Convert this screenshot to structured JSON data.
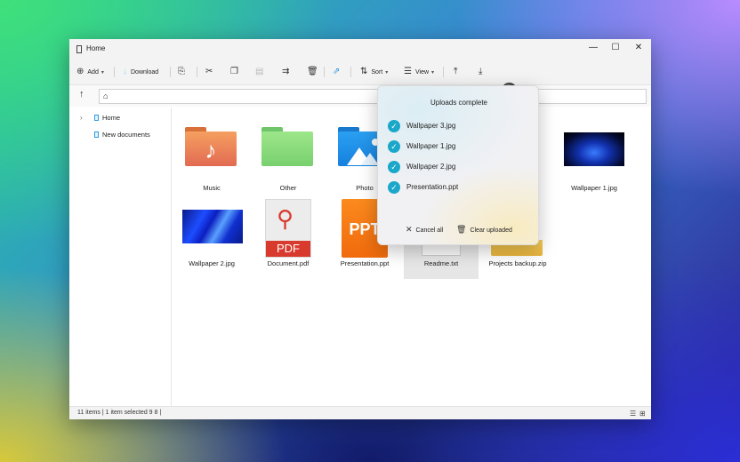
{
  "window": {
    "title": "Home",
    "minimize": "—",
    "maximize": "☐",
    "close": "✕"
  },
  "toolbar": {
    "add_label": "Add",
    "download_label": "Download",
    "sort_label": "Sort",
    "view_label": "View"
  },
  "address": {
    "path_icon": "home-icon"
  },
  "sidebar": {
    "items": [
      {
        "label": "Home",
        "icon": "document-icon"
      },
      {
        "label": "New documents",
        "icon": "document-icon"
      }
    ]
  },
  "files": [
    {
      "name": "Music",
      "type": "music-folder"
    },
    {
      "name": "Other",
      "type": "folder"
    },
    {
      "name": "Photo",
      "type": "photo-folder"
    },
    {
      "name": "Wallpaper 1.jpg",
      "type": "image"
    },
    {
      "name": "Wallpaper 2.jpg",
      "type": "image"
    },
    {
      "name": "Document.pdf",
      "type": "pdf",
      "badge": "PDF"
    },
    {
      "name": "Presentation.ppt",
      "type": "ppt",
      "badge": "PPT"
    },
    {
      "name": "Readme.txt",
      "type": "text",
      "selected": true
    },
    {
      "name": "Projects backup.zip",
      "type": "zip"
    }
  ],
  "status": {
    "text": "11 items | 1 item selected 9 8 |"
  },
  "uploads": {
    "title": "Uploads complete",
    "items": [
      {
        "name": "Wallpaper 3.jpg",
        "status": "complete"
      },
      {
        "name": "Wallpaper 1.jpg",
        "status": "complete"
      },
      {
        "name": "Wallpaper 2.jpg",
        "status": "complete"
      },
      {
        "name": "Presentation.ppt",
        "status": "complete"
      }
    ],
    "cancel_all": "Cancel all",
    "clear_uploaded": "Clear uploaded"
  },
  "colors": {
    "accent": "#1aa7c9",
    "folder_orange": "#f08a48",
    "folder_green": "#8fdc7f",
    "folder_blue": "#1e90e8",
    "pdf_red": "#d83a2d",
    "ppt_orange": "#f57c12"
  }
}
